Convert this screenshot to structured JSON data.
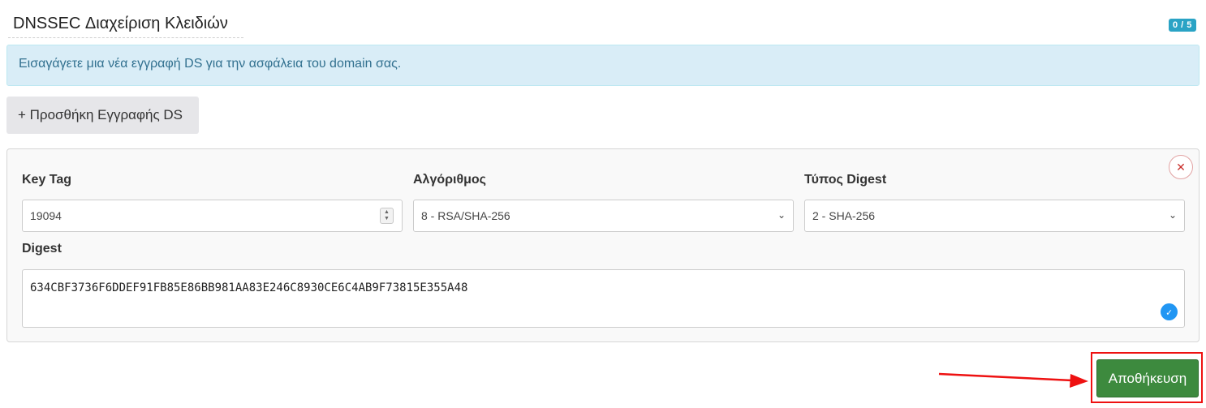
{
  "header": {
    "title": "DNSSEC Διαχείριση Κλειδιών",
    "count_badge": "0 / 5"
  },
  "alert": {
    "text": "Εισαγάγετε μια νέα εγγραφή DS για την ασφάλεια του domain σας."
  },
  "add_button_label": "+ Προσθήκη Εγγραφής DS",
  "record": {
    "key_tag": {
      "label": "Key Tag",
      "value": "19094"
    },
    "algorithm": {
      "label": "Αλγόριθμος",
      "selected": "8 - RSA/SHA-256"
    },
    "digest_type": {
      "label": "Τύπος Digest",
      "selected": "2 - SHA-256"
    },
    "digest": {
      "label": "Digest",
      "value": "634CBF3736F6DDEF91FB85E86BB981AA83E246C8930CE6C4AB9F73815E355A48"
    },
    "remove_icon": "close-icon"
  },
  "save_button_label": "Αποθήκευση",
  "colors": {
    "alert_bg": "#d9edf7",
    "alert_text": "#31708f",
    "badge": "#2aa3c5",
    "save_button": "#3d8a3e",
    "annotation_red": "#ee1111",
    "check": "#2196f3"
  }
}
